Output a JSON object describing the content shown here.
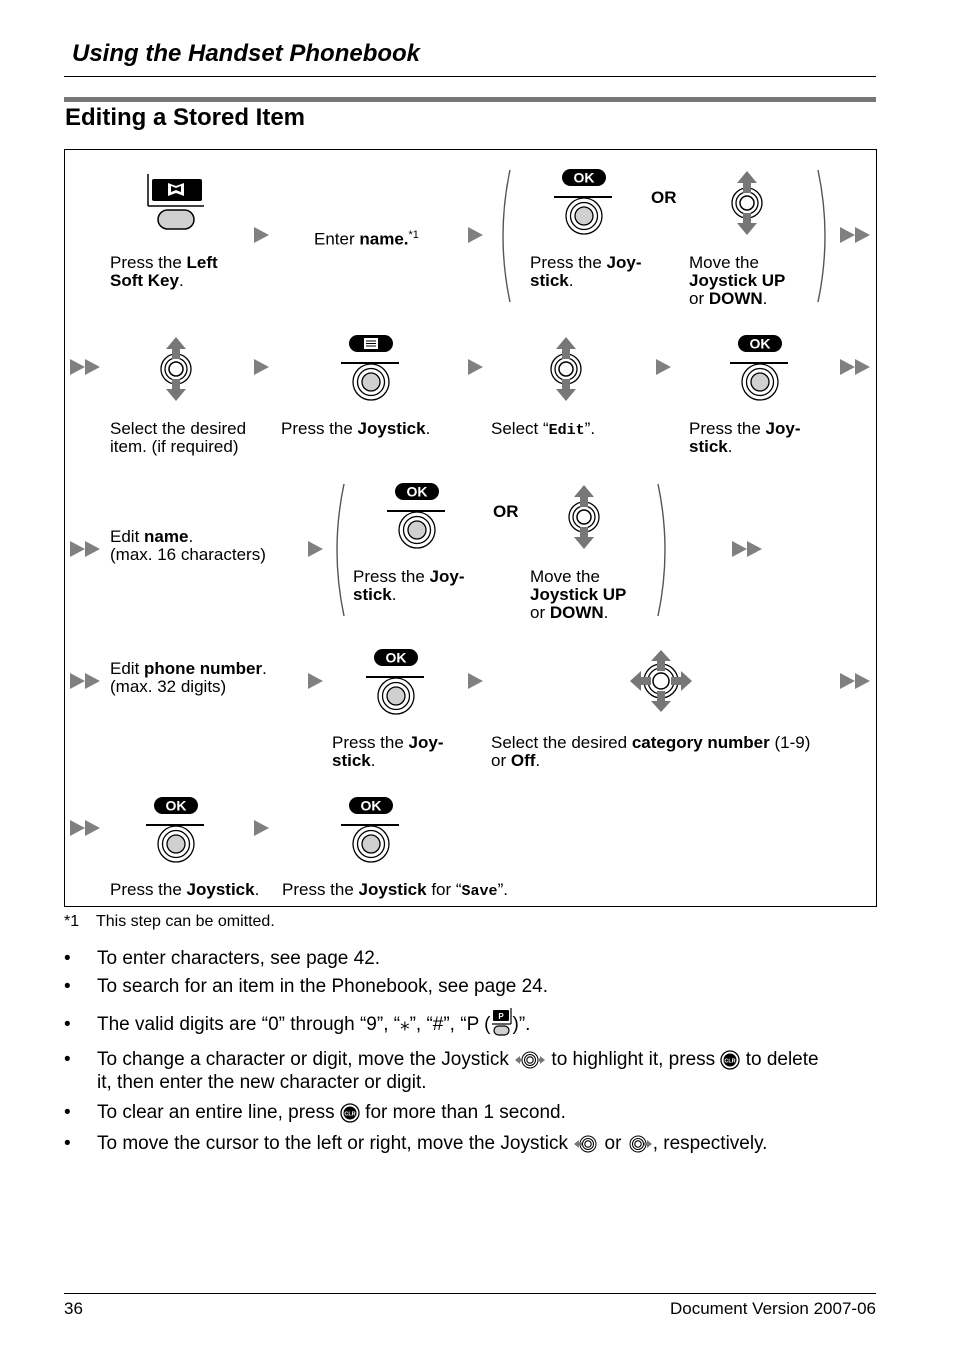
{
  "header": {
    "title": "Using the Handset Phonebook"
  },
  "section": {
    "title": "Editing a Stored Item"
  },
  "steps": {
    "row1": {
      "left_soft_key": {
        "pre": "Press the ",
        "bold": "Left Soft Key",
        "post": ".",
        "icon": "phonebook-soft-key-icon"
      },
      "enter_name": {
        "pre": "Enter ",
        "bold": "name.",
        "sup": "*1"
      },
      "press_joystick": {
        "pre": "Press the ",
        "bold1": "Joy-",
        "bold2": "stick",
        "post": ".",
        "key_label": "OK"
      },
      "or_label": "OR",
      "move_joystick": {
        "line1": "Move the",
        "bold": "Joystick UP",
        "or": "or ",
        "bold2": "DOWN",
        "post": "."
      }
    },
    "row2": {
      "select_item": {
        "line1": "Select the desired",
        "line2": "item. (if required)"
      },
      "press_joystick_menu": {
        "pre": "Press the ",
        "bold": "Joystick",
        "post": "."
      },
      "select_edit": {
        "pre": "Select “",
        "mono": "Edit",
        "post": "”."
      },
      "press_joystick_ok": {
        "pre": "Press the ",
        "bold1": "Joy-",
        "bold2": "stick",
        "post": ".",
        "key_label": "OK"
      }
    },
    "row3": {
      "edit_name": {
        "pre": "Edit ",
        "bold": "name",
        "post": ".",
        "line2": "(max. 16 characters)"
      },
      "press_joystick": {
        "pre": "Press the ",
        "bold1": "Joy-",
        "bold2": "stick",
        "post": ".",
        "key_label": "OK"
      },
      "or_label": "OR",
      "move_joystick": {
        "line1": "Move the",
        "bold": "Joystick UP",
        "or": "or ",
        "bold2": "DOWN",
        "post": "."
      }
    },
    "row4": {
      "edit_number": {
        "pre": "Edit ",
        "bold": "phone number",
        "post": ".",
        "line2": "(max. 32 digits)"
      },
      "press_joystick": {
        "pre": "Press the ",
        "bold1": "Joy-",
        "bold2": "stick",
        "post": ".",
        "key_label": "OK"
      },
      "select_category": {
        "pre": "Select the desired ",
        "bold": "category number",
        "post": " (1-9)",
        "or": "or ",
        "bold2": "Off",
        "post2": "."
      }
    },
    "row5": {
      "press_joystick": {
        "pre": "Press the ",
        "bold": "Joystick",
        "post": ".",
        "key_label": "OK"
      },
      "press_save": {
        "pre": "Press the ",
        "bold": "Joystick",
        "mid": " for “",
        "mono": "Save",
        "post": "”.",
        "key_label": "OK"
      }
    }
  },
  "footnote": {
    "mark": "*1",
    "text": "This step can be omitted."
  },
  "notes": [
    {
      "text": "To enter characters, see page 42."
    },
    {
      "text": "To search for an item in the Phonebook, see page 24."
    },
    {
      "pre": "The valid digits are “0” through “9”, “⁎”, “#”, “P (",
      "post": ")”.",
      "icon": "pause-key-icon"
    },
    {
      "pre": "To change a character or digit, move the Joystick ",
      "mid1": " to highlight it, press ",
      "mid2": " to delete",
      "line2": "it, then enter the new character or digit."
    },
    {
      "pre": "To clear an entire line, press ",
      "post": " for more than 1 second."
    },
    {
      "pre": "To move the cursor to the left or right, move the Joystick ",
      "mid": " or ",
      "post": ", respectively."
    }
  ],
  "footer": {
    "page": "36",
    "version": "Document Version 2007-06"
  },
  "colors": {
    "arrow": "#808080",
    "section_bar": "#777777",
    "key_fill": "#000000",
    "button_fill": "#d0d0d0"
  }
}
